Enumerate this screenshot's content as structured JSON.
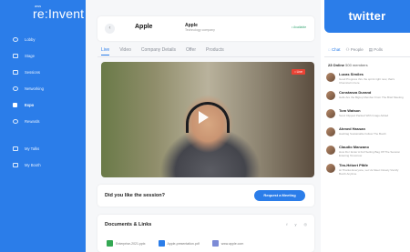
{
  "brand": {
    "small": "aws",
    "big": "re:Invent"
  },
  "nav": {
    "items": [
      {
        "label": "Lobby",
        "icon": "home-icon"
      },
      {
        "label": "Stage",
        "icon": "stage-icon"
      },
      {
        "label": "Sessions",
        "icon": "sessions-icon"
      },
      {
        "label": "Networking",
        "icon": "networking-icon"
      },
      {
        "label": "Expo",
        "icon": "expo-icon",
        "active": true
      },
      {
        "label": "Rewards",
        "icon": "rewards-icon"
      }
    ],
    "bottom": [
      {
        "label": "My Talks",
        "icon": "talks-icon"
      },
      {
        "label": "My Booth",
        "icon": "booth-icon"
      }
    ]
  },
  "company": {
    "back_symbol": "‹",
    "logo_symbol": "",
    "logo_word": "Apple",
    "name": "Apple",
    "subtitle": "Technology company",
    "status": "• Available"
  },
  "tabs": [
    "Live",
    "Video",
    "Company Details",
    "Offer",
    "Products"
  ],
  "video": {
    "badge": "• Live"
  },
  "cta": {
    "question": "Did you like the session?",
    "button": "Request a Meeting"
  },
  "docs": {
    "title": "Documents & Links",
    "social": [
      "f",
      "y",
      "◎"
    ],
    "files": [
      {
        "name": "Enterprise-2021.pptx",
        "color": "#34a853"
      },
      {
        "name": "Apple-presentation.pdf",
        "color": "#2b7de9"
      },
      {
        "name": "www.apple.com",
        "color": "#7c8bd6"
      }
    ]
  },
  "sponsor": {
    "label": "twitter"
  },
  "right_tabs": [
    "Chat",
    "People",
    "Polls"
  ],
  "online": {
    "count": "23 Online",
    "text": "500 members"
  },
  "chats": [
    {
      "name": "Lucas Simões",
      "text": "Good Progress thru the sprint right now, that's Chemical in here"
    },
    {
      "name": "Constanza Durand",
      "text": "Hello Are the Bigtop Member From The Brief Meeting"
    },
    {
      "name": "Tom Watson",
      "text": "Send Clipped Packed With Image Added"
    },
    {
      "name": "Ahmed Hassan",
      "text": "Hashtag Sustainable Follow The Booth"
    },
    {
      "name": "Claudio Manzano",
      "text": "How Do I Enter A Full Setting Bag Off The Session Entering Tomorrow"
    },
    {
      "name": "Tim-Hébert Pfäfe",
      "text": "Hi Thanks Everyone, Let Us Meet Closely Via My Booth Anytime"
    }
  ],
  "colors": {
    "accent": "#2b7de9",
    "live": "#ea4335",
    "available": "#3aa876"
  }
}
